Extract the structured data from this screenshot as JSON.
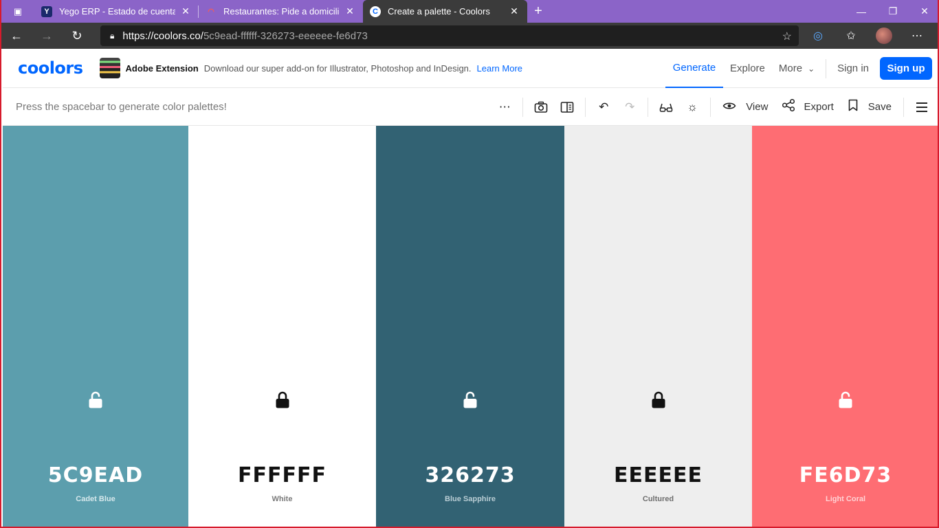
{
  "browser": {
    "tabs": [
      {
        "title": "Yego ERP - Estado de cuenta",
        "active": false
      },
      {
        "title": "Restaurantes: Pide a domicilio co",
        "active": false
      },
      {
        "title": "Create a palette - Coolors",
        "active": true
      }
    ],
    "url_base": "https://coolors.co/",
    "url_path": "5c9ead-ffffff-326273-eeeeee-fe6d73"
  },
  "header": {
    "logo": "coolors",
    "promo_title": "Adobe Extension",
    "promo_text": "Download our super add-on for Illustrator, Photoshop and InDesign.",
    "promo_link": "Learn More",
    "nav": {
      "generate": "Generate",
      "explore": "Explore",
      "more": "More",
      "signin": "Sign in",
      "signup": "Sign up"
    }
  },
  "toolbar": {
    "hint": "Press the spacebar to generate color palettes!",
    "view_label": "View",
    "export_label": "Export",
    "save_label": "Save"
  },
  "palette": [
    {
      "hex": "5C9EAD",
      "name": "Cadet Blue",
      "color": "#5c9ead",
      "text_color": "#ffffff",
      "name_color": "#d6e8ec",
      "locked": false
    },
    {
      "hex": "FFFFFF",
      "name": "White",
      "color": "#ffffff",
      "text_color": "#111111",
      "name_color": "#7a7a7a",
      "locked": true
    },
    {
      "hex": "326273",
      "name": "Blue Sapphire",
      "color": "#326273",
      "text_color": "#ffffff",
      "name_color": "#b9cdd4",
      "locked": false
    },
    {
      "hex": "EEEEEE",
      "name": "Cultured",
      "color": "#eeeeee",
      "text_color": "#111111",
      "name_color": "#6e6e6e",
      "locked": true
    },
    {
      "hex": "FE6D73",
      "name": "Light Coral",
      "color": "#fe6d73",
      "text_color": "#ffffff",
      "name_color": "#ffd3d5",
      "locked": false
    }
  ]
}
